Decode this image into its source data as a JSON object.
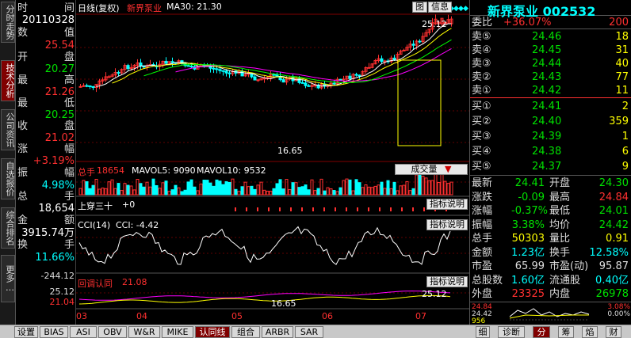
{
  "left_tabs": [
    {
      "label": "分时走势",
      "active": false
    },
    {
      "label": "技术分析",
      "active": true
    },
    {
      "label": "公司资讯",
      "active": false
    },
    {
      "label": "自选报价",
      "active": false
    },
    {
      "label": "综合排名",
      "active": false
    },
    {
      "label": "更多…",
      "active": false
    }
  ],
  "data_panel": {
    "time_label": "时",
    "time_label2": "间",
    "date": "20110328",
    "rows": [
      {
        "l": "数",
        "r": "值"
      },
      {
        "l": "开",
        "r": "盘"
      },
      {
        "l": "最",
        "r": "高"
      },
      {
        "l": "最",
        "r": "低"
      },
      {
        "l": "收",
        "r": "盘"
      },
      {
        "l": "涨",
        "r": "幅"
      },
      {
        "l": "振",
        "r": "幅"
      },
      {
        "l": "总",
        "r": "手"
      },
      {
        "l": "金",
        "r": "额"
      },
      {
        "l": "换",
        "r": "手"
      }
    ],
    "open": "25.54",
    "high": "20.27",
    "low": "21.26",
    "close": "20.25",
    "prev": "21.02",
    "change_pct": "+3.19%",
    "amplitude": "4.98%",
    "volume": "18,654",
    "amount": "3915.74万",
    "turnover": "11.66%",
    "bottom_val": "-244.12",
    "low_val1": "25.12",
    "low_val2": "21.04"
  },
  "header": {
    "title": "日线(复权)",
    "stock_name": "新界泵业",
    "ma30": "MA30: 21.30",
    "buttons": [
      "图",
      "信息"
    ]
  },
  "chart_data": {
    "type": "candlestick",
    "price_high_label": "25.12",
    "price_low_label": "16.65",
    "x_ticks": [
      "03",
      "04",
      "05",
      "06",
      "07"
    ],
    "volume_panel": {
      "label": "总手",
      "value": "18654",
      "mavol5": "MAVOL5: 9090",
      "mavol10": "MAVOL10: 9532",
      "button": "成交量"
    },
    "ss_panel": {
      "label": "上穿三十",
      "value": "+0",
      "button": "指标说明"
    },
    "cci_panel": {
      "label": "CCI(14)",
      "value": "CCI: -4.42",
      "button": "指标说明"
    },
    "pullback_panel": {
      "label": "回调认同",
      "value": "21.08",
      "button": "指标说明",
      "hi": "25.12",
      "lo": "16.65"
    }
  },
  "right_panel": {
    "title": "新界泵业 002532",
    "committee_label": "委比",
    "committee_value": "+36.07%",
    "committee_vol": "200",
    "sells": [
      {
        "label": "卖⑤",
        "price": "24.46",
        "vol": "18"
      },
      {
        "label": "卖④",
        "price": "24.45",
        "vol": "31"
      },
      {
        "label": "卖③",
        "price": "24.44",
        "vol": "40"
      },
      {
        "label": "卖②",
        "price": "24.43",
        "vol": "77"
      },
      {
        "label": "卖①",
        "price": "24.42",
        "vol": "11"
      }
    ],
    "buys": [
      {
        "label": "买①",
        "price": "24.41",
        "vol": "2"
      },
      {
        "label": "买②",
        "price": "24.40",
        "vol": "359"
      },
      {
        "label": "买③",
        "price": "24.39",
        "vol": "1"
      },
      {
        "label": "买④",
        "price": "24.38",
        "vol": "6"
      },
      {
        "label": "买⑤",
        "price": "24.37",
        "vol": "9"
      }
    ],
    "stats": [
      {
        "l1": "最新",
        "v1": "24.41",
        "l2": "开盘",
        "v2": "24.30"
      },
      {
        "l1": "涨跌",
        "v1": "-0.09",
        "l2": "最高",
        "v2": "24.84"
      },
      {
        "l1": "涨幅",
        "v1": "-0.37%",
        "l2": "最低",
        "v2": "24.01"
      },
      {
        "l1": "振幅",
        "v1": "3.38%",
        "l2": "均价",
        "v2": "24.42"
      },
      {
        "l1": "总手",
        "v1": "50303",
        "l2": "量比",
        "v2": "0.91"
      },
      {
        "l1": "金额",
        "v1": "1.23亿",
        "l2": "换手",
        "v2": "12.58%"
      },
      {
        "l1": "市盈",
        "v1": "65.99",
        "l2": "市盈(动)",
        "v2": "95.87"
      },
      {
        "l1": "总股数",
        "v1": "1.60亿",
        "l2": "流通股",
        "v2": "0.40亿"
      },
      {
        "l1": "外盘",
        "v1": "23325",
        "l2": "内盘",
        "v2": "26978"
      }
    ],
    "mini_labels": [
      "24.84",
      "3.08%",
      "24.42",
      "0.00%",
      "956"
    ]
  },
  "bottom_tabs": [
    "设置",
    "BIAS",
    "ASI",
    "OBV",
    "W&R",
    "MIKE",
    "认同线",
    "组合",
    "ARBR",
    "SAR"
  ],
  "bottom_active": "认同线",
  "right_bottom_tabs": [
    "细",
    "诊断",
    "分",
    "筹",
    "焰",
    "财"
  ],
  "right_bottom_active": "分",
  "colors": {
    "up": "#ff3030",
    "down": "#00ffff",
    "bg": "#000000",
    "accent": "#800000"
  }
}
